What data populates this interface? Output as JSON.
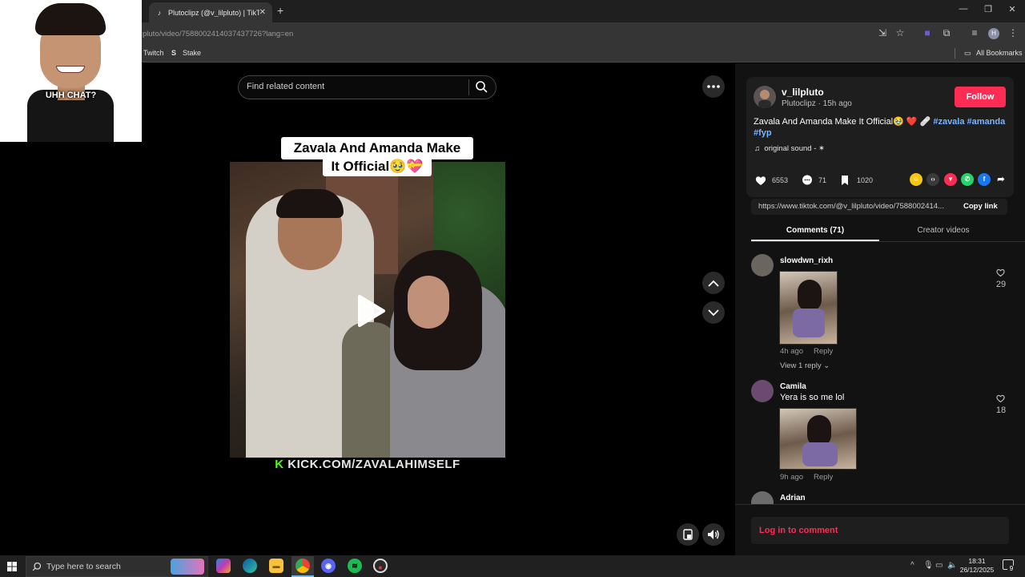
{
  "browser": {
    "tab_title": "Plutoclipz (@v_lilpluto) | TikTok",
    "tab_close": "✕",
    "new_tab": "+",
    "url": "pluto/video/7588002414037437726?lang=en",
    "window_controls": {
      "minimize": "—",
      "restore": "❐",
      "close": "✕"
    },
    "bookmarks": [
      "Twitch",
      "Stake"
    ],
    "all_bookmarks": "All Bookmarks",
    "profile_initial": "H"
  },
  "webcam": {
    "caption": "UHH CHAT?"
  },
  "search": {
    "placeholder": "Find related content"
  },
  "video": {
    "caption_line1": "Zavala And Amanda Make",
    "caption_line2": "It Official🥹💝",
    "watermark_k": "K",
    "watermark_text": "KICK.COM/ZAVALAHIMSELF"
  },
  "author": {
    "username": "v_lilpluto",
    "meta": "Plutoclipz · 15h ago",
    "follow": "Follow",
    "description": "Zavala And Amanda Make It Official🥹 ❤️ 🩹",
    "hashtags": "#zavala #amanda",
    "hashtag_line2": "#fyp",
    "sound_icon": "♫",
    "sound": "original sound - ✶"
  },
  "stats": {
    "likes": "6553",
    "comments": "71",
    "saves": "1020"
  },
  "share": {
    "link": "https://www.tiktok.com/@v_lilpluto/video/7588002414...",
    "copy": "Copy link"
  },
  "tabs": {
    "comments": "Comments (71)",
    "creator": "Creator videos"
  },
  "comments": [
    {
      "user": "slowdwn_rixh",
      "text": "",
      "time": "4h ago",
      "reply": "Reply",
      "likes": "29",
      "view_replies": "View 1 reply",
      "chevron": "⌄"
    },
    {
      "user": "Camila",
      "text": "Yera is so me lol",
      "time": "9h ago",
      "reply": "Reply",
      "likes": "18"
    },
    {
      "user": "Adrian"
    }
  ],
  "login": "Log in to comment",
  "taskbar": {
    "search_placeholder": "Type here to search",
    "time": "18:31",
    "date": "26/12/2025",
    "notif_count": "9"
  },
  "colors": {
    "accent": "#fe2c55",
    "hashtag": "#7ab4ff",
    "kick": "#53fc18"
  }
}
